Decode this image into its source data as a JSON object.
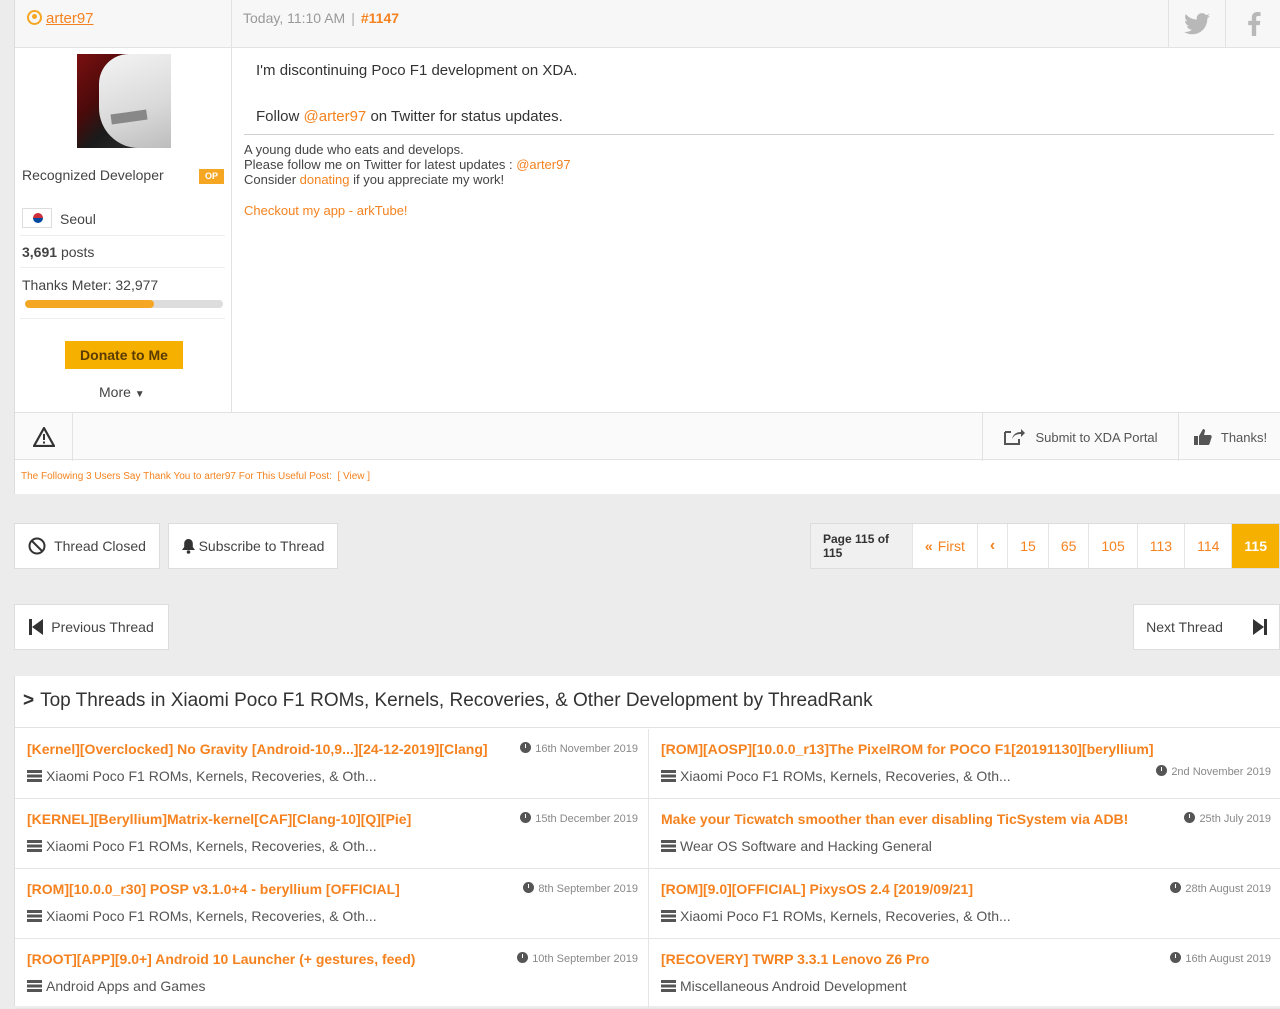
{
  "post": {
    "username": "arter97",
    "time": "Today, 11:10 AM",
    "separator": "|",
    "post_number": "#1147",
    "user_title": "Recognized Developer",
    "op_badge": "OP",
    "location": "Seoul",
    "posts_count": "3,691",
    "posts_label": "posts",
    "thanks_meter_label": "Thanks Meter: 32,977",
    "thanks_meter_fill": 0.65,
    "donate_label": "Donate to Me",
    "more_label": "More",
    "message_line1": "I'm discontinuing Poco F1 development on XDA.",
    "message_line2_prefix": "Follow ",
    "message_line2_link": "@arter97",
    "message_line2_suffix": " on Twitter for status updates.",
    "signature": {
      "line1": "A young dude who eats and develops.",
      "line2_prefix": "Please follow me on Twitter for latest updates : ",
      "line2_link": "@arter97",
      "line3_prefix": "Consider ",
      "line3_link": "donating",
      "line3_suffix": " if you appreciate my work!",
      "app_link": "Checkout my app - arkTube!"
    },
    "submit_portal_label": "Submit to XDA Portal",
    "thanks_label": "Thanks!",
    "thanks_users_text": "The Following 3 Users Say Thank You to arter97 For This Useful Post:",
    "view_label": "[ View ]"
  },
  "nav": {
    "thread_closed": "Thread Closed",
    "subscribe": "Subscribe to Thread",
    "page_label": "Page 115 of 115",
    "first_label": "First",
    "prev_label": "‹",
    "pages": [
      "15",
      "65",
      "105",
      "113",
      "114",
      "115"
    ],
    "current_page": "115",
    "previous_thread": "Previous Thread",
    "next_thread": "Next Thread"
  },
  "top_threads": {
    "header": "Top Threads in Xiaomi Poco F1 ROMs, Kernels, Recoveries, & Other Development by ThreadRank",
    "items": [
      {
        "title": "[Kernel][Overclocked] No Gravity [Android-10,9...][24-12-2019][Clang]",
        "date": "16th November 2019",
        "forum": "Xiaomi Poco F1 ROMs, Kernels, Recoveries, & Oth..."
      },
      {
        "title": "[ROM][AOSP][10.0.0_r13]The PixelROM for POCO F1[20191130][beryllium]",
        "date": "2nd November 2019",
        "forum": "Xiaomi Poco F1 ROMs, Kernels, Recoveries, & Oth..."
      },
      {
        "title": "[KERNEL][Beryllium]Matrix-kernel[CAF][Clang-10][Q][Pie]",
        "date": "15th December 2019",
        "forum": "Xiaomi Poco F1 ROMs, Kernels, Recoveries, & Oth..."
      },
      {
        "title": "Make your Ticwatch smoother than ever disabling TicSystem via ADB!",
        "date": "25th July 2019",
        "forum": "Wear OS Software and Hacking General"
      },
      {
        "title": "[ROM][10.0.0_r30] POSP v3.1.0+4 - beryllium [OFFICIAL]",
        "date": "8th September 2019",
        "forum": "Xiaomi Poco F1 ROMs, Kernels, Recoveries, & Oth..."
      },
      {
        "title": "[ROM][9.0][OFFICIAL] PixysOS 2.4 [2019/09/21]",
        "date": "28th August 2019",
        "forum": "Xiaomi Poco F1 ROMs, Kernels, Recoveries, & Oth..."
      },
      {
        "title": "[ROOT][APP][9.0+] Android 10 Launcher (+ gestures, feed)",
        "date": "10th September 2019",
        "forum": "Android Apps and Games"
      },
      {
        "title": "[RECOVERY] TWRP 3.3.1 Lenovo Z6 Pro",
        "date": "16th August 2019",
        "forum": "Miscellaneous Android Development"
      }
    ]
  },
  "colors": {
    "accent": "#f5821f",
    "button_yellow": "#f5b000",
    "background": "#ececec"
  }
}
